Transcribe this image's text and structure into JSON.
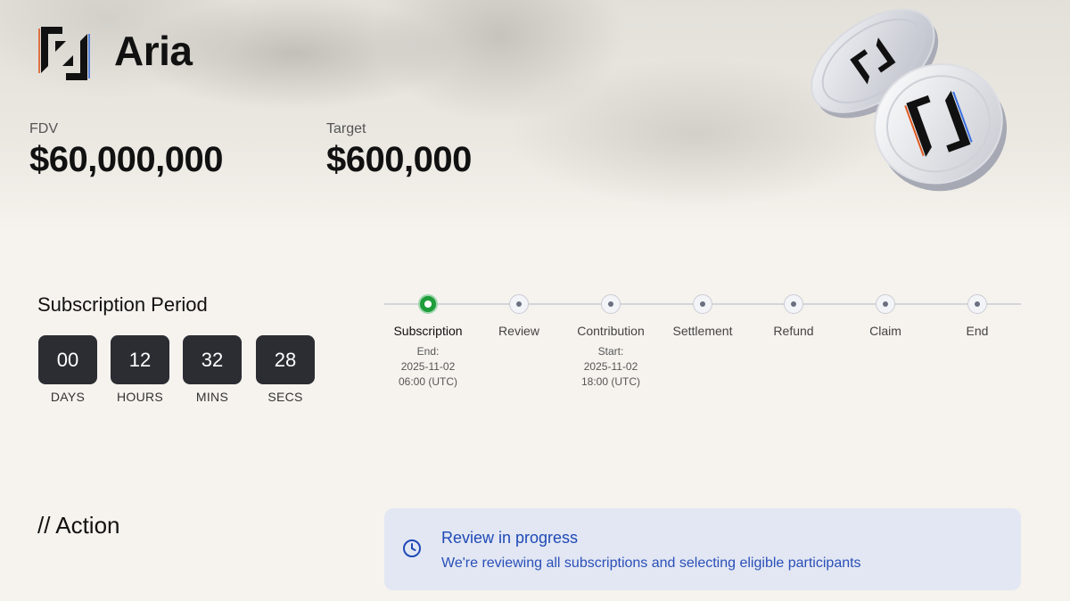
{
  "header": {
    "brand": "Aria",
    "logo_icon": "aria-logo-icon",
    "fdv_label": "FDV",
    "fdv_value": "$60,000,000",
    "target_label": "Target",
    "target_value": "$600,000"
  },
  "countdown": {
    "title": "Subscription Period",
    "units": [
      {
        "value": "00",
        "label": "DAYS"
      },
      {
        "value": "12",
        "label": "HOURS"
      },
      {
        "value": "32",
        "label": "MINS"
      },
      {
        "value": "28",
        "label": "SECS"
      }
    ]
  },
  "timeline": {
    "active_color": "#1f9d3a",
    "steps": [
      {
        "name": "Subscription",
        "active": true,
        "sub": [
          "End:",
          "2025-11-02",
          "06:00 (UTC)"
        ]
      },
      {
        "name": "Review",
        "active": false,
        "sub": []
      },
      {
        "name": "Contribution",
        "active": false,
        "sub": [
          "Start:",
          "2025-11-02",
          "18:00 (UTC)"
        ]
      },
      {
        "name": "Settlement",
        "active": false,
        "sub": []
      },
      {
        "name": "Refund",
        "active": false,
        "sub": []
      },
      {
        "name": "Claim",
        "active": false,
        "sub": []
      },
      {
        "name": "End",
        "active": false,
        "sub": []
      }
    ]
  },
  "action": {
    "title": "// Action",
    "notice": {
      "icon": "clock-icon",
      "title": "Review in progress",
      "text": "We're reviewing all subscriptions and selecting eligible participants",
      "color": "#1f49b6"
    }
  }
}
